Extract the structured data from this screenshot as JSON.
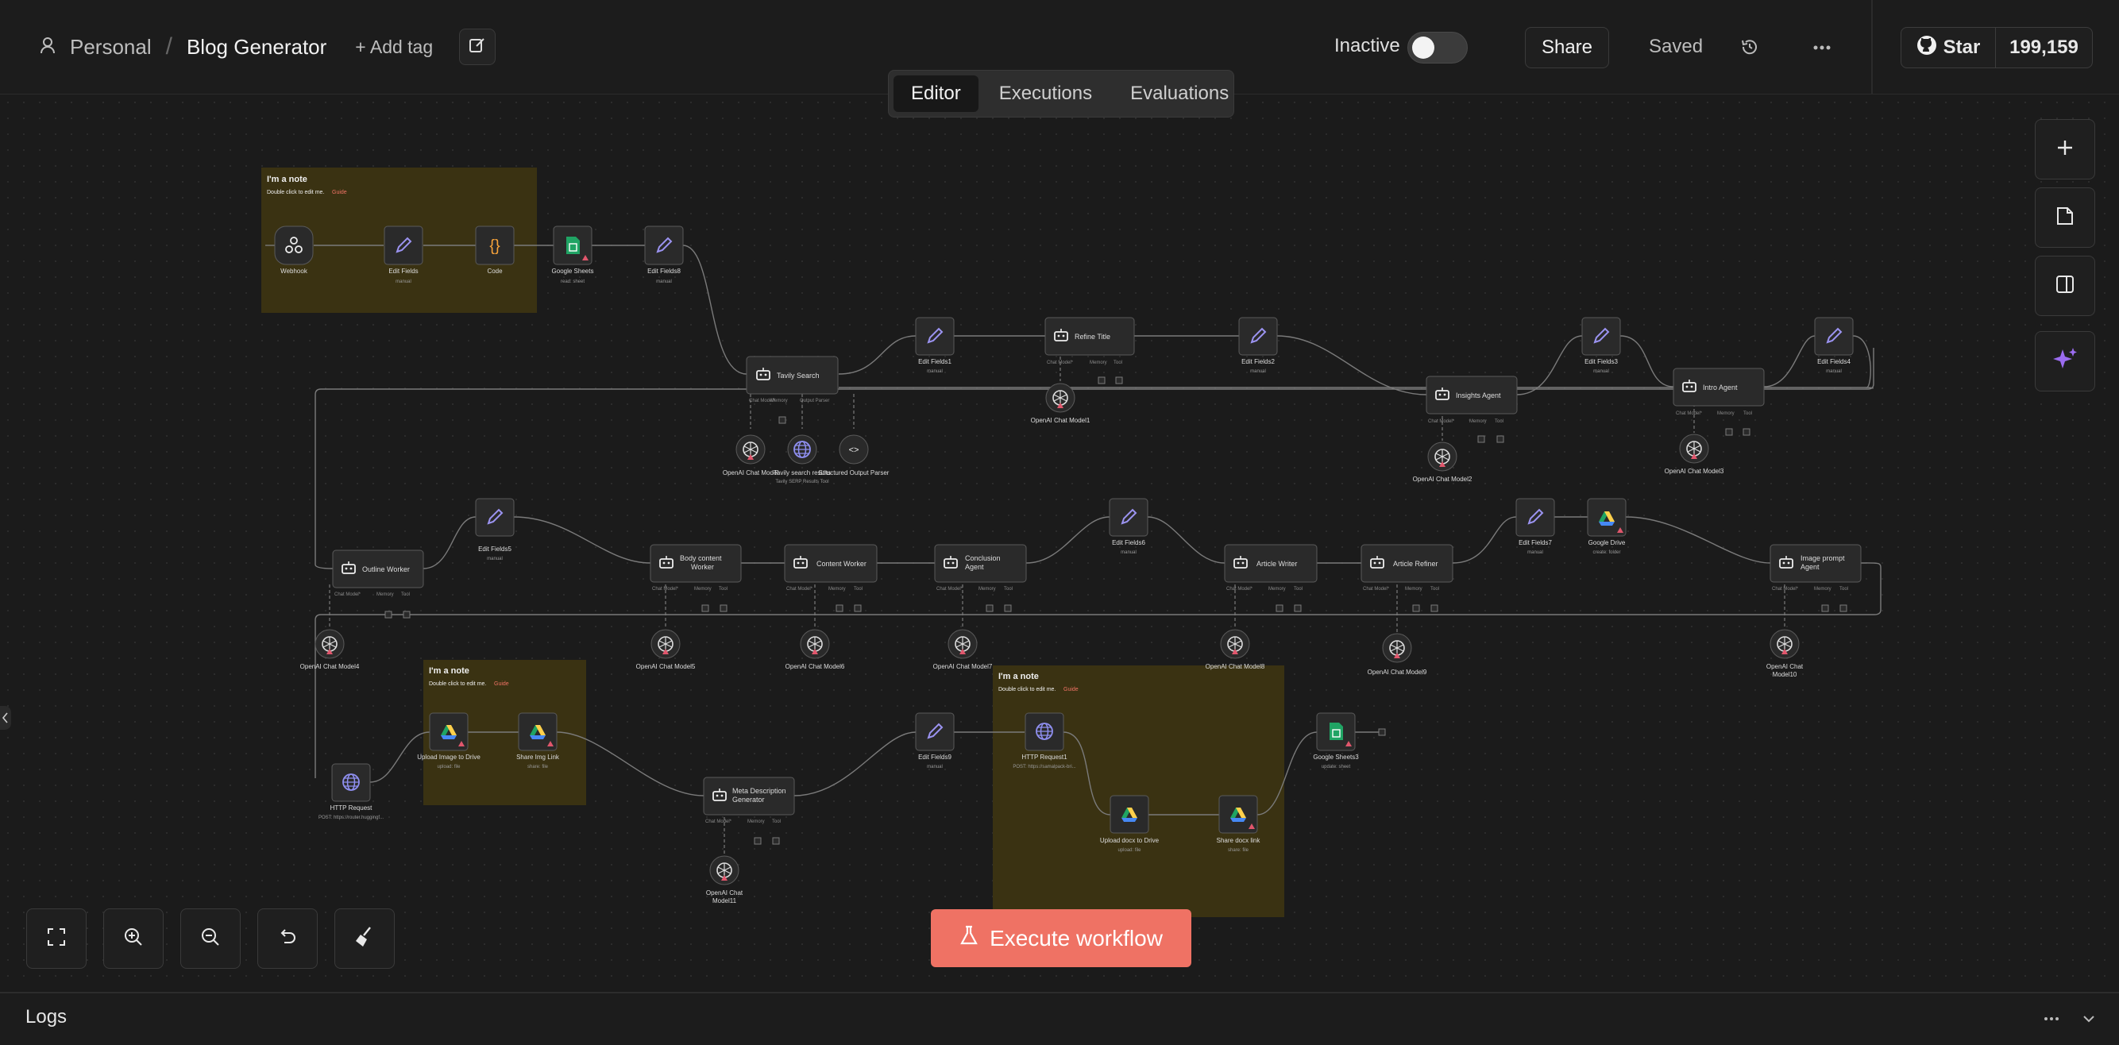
{
  "header": {
    "breadcrumb_personal": "Personal",
    "breadcrumb_sep": "/",
    "workflow_title": "Blog Generator",
    "add_tag": "+ Add tag",
    "inactive_label": "Inactive",
    "share_label": "Share",
    "saved_label": "Saved",
    "github_star": "Star",
    "github_count": "199,159"
  },
  "tabs": [
    {
      "label": "Editor",
      "active": true
    },
    {
      "label": "Executions",
      "active": false
    },
    {
      "label": "Evaluations",
      "active": false
    }
  ],
  "notes": [
    {
      "title": "I'm a note",
      "sub": "Double click to edit me.",
      "link": "Guide"
    },
    {
      "title": "I'm a note",
      "sub": "Double click to edit me.",
      "link": "Guide"
    },
    {
      "title": "I'm a note",
      "sub": "Double click to edit me.",
      "link": "Guide"
    }
  ],
  "nodes": {
    "webhook": {
      "label": "Webhook",
      "sub": ""
    },
    "edit_fields": {
      "label": "Edit Fields",
      "sub": "manual"
    },
    "code": {
      "label": "Code",
      "sub": ""
    },
    "google_sheets": {
      "label": "Google Sheets",
      "sub": "read: sheet"
    },
    "edit_fields8": {
      "label": "Edit Fields8",
      "sub": "manual"
    },
    "tavily_search": {
      "label": "Tavily Search"
    },
    "edit_fields1": {
      "label": "Edit Fields1",
      "sub": "manual"
    },
    "refine_title": {
      "label": "Refine Title"
    },
    "edit_fields2": {
      "label": "Edit Fields2",
      "sub": "manual"
    },
    "insights_agent": {
      "label": "Insights Agent"
    },
    "edit_fields3": {
      "label": "Edit Fields3",
      "sub": "manual"
    },
    "intro_agent": {
      "label": "Intro Agent"
    },
    "edit_fields4": {
      "label": "Edit Fields4",
      "sub": "manual"
    },
    "openai_model": {
      "label": "OpenAI Chat Model"
    },
    "tavily_results": {
      "label": "Tavily search results",
      "sub": "Tavily SERP Results Tool"
    },
    "structured_parser": {
      "label": "Structured Output Parser"
    },
    "openai_model1": {
      "label": "OpenAI Chat Model1"
    },
    "openai_model2": {
      "label": "OpenAI Chat Model2"
    },
    "openai_model3": {
      "label": "OpenAI Chat Model3"
    },
    "outline_worker": {
      "label": "Outline Worker"
    },
    "edit_fields5": {
      "label": "Edit Fields5",
      "sub": "manual"
    },
    "body_worker": {
      "label": "Body content Worker"
    },
    "content_worker": {
      "label": "Content Worker"
    },
    "conclusion_agent": {
      "label": "Conclusion Agent"
    },
    "edit_fields6": {
      "label": "Edit Fields6",
      "sub": "manual"
    },
    "article_writer": {
      "label": "Article Writer"
    },
    "article_refiner": {
      "label": "Article Refiner"
    },
    "edit_fields7": {
      "label": "Edit Fields7",
      "sub": "manual"
    },
    "google_drive": {
      "label": "Google Drive",
      "sub": "create: folder"
    },
    "image_prompt_agent": {
      "label": "Image prompt Agent"
    },
    "openai_model4": {
      "label": "OpenAI Chat Model4"
    },
    "openai_model5": {
      "label": "OpenAI Chat Model5"
    },
    "openai_model6": {
      "label": "OpenAI Chat Model6"
    },
    "openai_model7": {
      "label": "OpenAI Chat Model7"
    },
    "openai_model8": {
      "label": "OpenAI Chat Model8"
    },
    "openai_model9": {
      "label": "OpenAI Chat Model9"
    },
    "openai_model10": {
      "label": "OpenAI Chat Model10"
    },
    "http_request": {
      "label": "HTTP Request",
      "sub": "POST: https://router.huggingf..."
    },
    "upload_image": {
      "label": "Upload Image to Drive",
      "sub": "upload: file"
    },
    "share_img": {
      "label": "Share Img Link",
      "sub": "share: file"
    },
    "meta_desc": {
      "label": "Meta Description Generator"
    },
    "openai_model11": {
      "label": "OpenAI Chat Model11"
    },
    "edit_fields9": {
      "label": "Edit Fields9",
      "sub": "manual"
    },
    "http_request1": {
      "label": "HTTP Request1",
      "sub": "POST: https://samalpack-bri..."
    },
    "upload_docx": {
      "label": "Upload docx to Drive",
      "sub": "upload: file"
    },
    "share_docx": {
      "label": "Share docx link",
      "sub": "share: file"
    },
    "google_sheets3": {
      "label": "Google Sheets3",
      "sub": "update: sheet"
    }
  },
  "ports": {
    "chat_model": "Chat Model*",
    "memory": "Memory",
    "tool": "Tool",
    "model": "Model",
    "output_parser": "Output Parser"
  },
  "execute_label": "Execute workflow",
  "logs_label": "Logs",
  "colors": {
    "accent": "#ef7264",
    "note_bg": "#3a3212",
    "node_bg": "#2a2a2a",
    "edit_icon": "#9b93f0",
    "error": "#e0566c"
  }
}
